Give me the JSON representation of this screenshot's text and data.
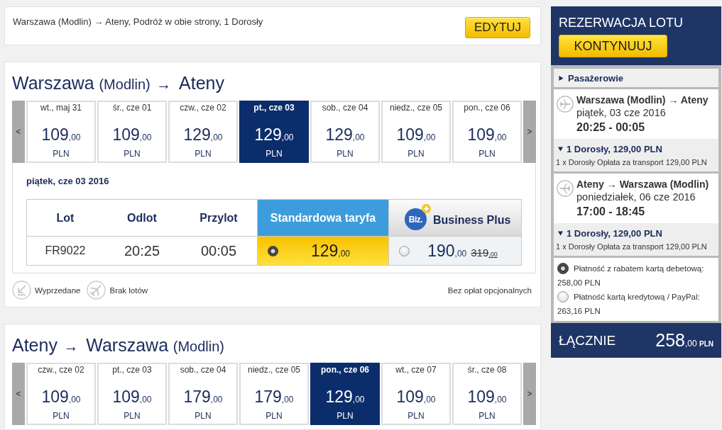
{
  "search_summary": {
    "text": "Warszawa (Modlin) → Ateny, Podróż w obie strony, 1 Dorosły",
    "edit_button": "EDYTUJ"
  },
  "flights": [
    {
      "title_parts": [
        {
          "kind": "city",
          "text": "Warszawa"
        },
        {
          "kind": "airport",
          "text": "(Modlin)"
        },
        {
          "kind": "arrow",
          "text": "→"
        },
        {
          "kind": "city",
          "text": "Ateny"
        }
      ],
      "carousel": {
        "previous": "<",
        "next": ">",
        "days": [
          {
            "date": "wt., maj 31",
            "price": "109",
            "decimals": ",00",
            "currency": "PLN",
            "selected": false
          },
          {
            "date": "śr., cze 01",
            "price": "109",
            "decimals": ",00",
            "currency": "PLN",
            "selected": false
          },
          {
            "date": "czw., cze 02",
            "price": "129",
            "decimals": ",00",
            "currency": "PLN",
            "selected": false
          },
          {
            "date": "pt., cze 03",
            "price": "129",
            "decimals": ",00",
            "currency": "PLN",
            "selected": true
          },
          {
            "date": "sob., cze 04",
            "price": "129",
            "decimals": ",00",
            "currency": "PLN",
            "selected": false
          },
          {
            "date": "niedz., cze 05",
            "price": "109",
            "decimals": ",00",
            "currency": "PLN",
            "selected": false
          },
          {
            "date": "pon., cze 06",
            "price": "109",
            "decimals": ",00",
            "currency": "PLN",
            "selected": false
          }
        ]
      },
      "selected_day": {
        "heading": "piątek, cze 03 2016",
        "columns": [
          "Lot",
          "Odlot",
          "Przylot"
        ],
        "fare_types": [
          {
            "kind": "standard",
            "label": "Standardowa taryfa"
          },
          {
            "kind": "business",
            "label": "Business Plus",
            "badge": "Biz."
          }
        ],
        "rows": [
          {
            "flight": "FR9022",
            "departure": "20:25",
            "arrival": "00:05",
            "fares": [
              {
                "price": "129",
                "decimals": ",00",
                "selected": true
              },
              {
                "price": "190",
                "decimals": ",00",
                "old_price": "319",
                "old_decimals": ",00",
                "selected": false
              }
            ]
          }
        ],
        "legend": [
          {
            "kind": "sold_out",
            "label": "Wyprzedane"
          },
          {
            "kind": "no_flights",
            "label": "Brak lotów"
          }
        ],
        "note": "Bez opłat opcjonalnych"
      }
    },
    {
      "title_parts": [
        {
          "kind": "city",
          "text": "Ateny"
        },
        {
          "kind": "arrow",
          "text": "→"
        },
        {
          "kind": "city",
          "text": "Warszawa"
        },
        {
          "kind": "airport",
          "text": "(Modlin)"
        }
      ],
      "carousel": {
        "previous": "<",
        "next": ">",
        "days": [
          {
            "date": "czw., cze 02",
            "price": "109",
            "decimals": ",00",
            "currency": "PLN",
            "selected": false
          },
          {
            "date": "pt., cze 03",
            "price": "109",
            "decimals": ",00",
            "currency": "PLN",
            "selected": false
          },
          {
            "date": "sob., cze 04",
            "price": "179",
            "decimals": ",00",
            "currency": "PLN",
            "selected": false
          },
          {
            "date": "niedz., cze 05",
            "price": "179",
            "decimals": ",00",
            "currency": "PLN",
            "selected": false
          },
          {
            "date": "pon., cze 06",
            "price": "129",
            "decimals": ",00",
            "currency": "PLN",
            "selected": true
          },
          {
            "date": "wt., cze 07",
            "price": "109",
            "decimals": ",00",
            "currency": "PLN",
            "selected": false
          },
          {
            "date": "śr., cze 08",
            "price": "109",
            "decimals": ",00",
            "currency": "PLN",
            "selected": false
          }
        ]
      }
    }
  ],
  "booking": {
    "title": "REZERWACJA LOTU",
    "continue_button": "KONTYNUUJ",
    "passengers": {
      "label": "Pasażerowie",
      "expanded": false
    },
    "legs": [
      {
        "kind": "outbound",
        "route": "Warszawa (Modlin) → Ateny",
        "date": "piątek, 03 cze 2016",
        "times": "20:25 - 00:05",
        "fare": {
          "label": "1 Dorosły, 129,00 PLN",
          "expanded": true,
          "detail": "1 x Dorosły Opłata za transport 129,00 PLN"
        }
      },
      {
        "kind": "inbound",
        "route": "Ateny → Warszawa (Modlin)",
        "date": "poniedziałek, 06 cze 2016",
        "times": "17:00 - 18:45",
        "fare": {
          "label": "1 Dorosły, 129,00 PLN",
          "expanded": true,
          "detail": "1 x Dorosły Opłata za transport 129,00 PLN"
        }
      }
    ],
    "payment_options": [
      {
        "label": "Płatność z rabatem kartą debetową:",
        "amount": "258,00 PLN",
        "selected": true
      },
      {
        "label": "Płatność kartą kredytową / PayPal:",
        "amount": "263,16 PLN",
        "selected": false
      }
    ],
    "total": {
      "label": "ŁĄCZNIE",
      "amount": "258",
      "decimals": ",00",
      "currency": "PLN"
    }
  }
}
